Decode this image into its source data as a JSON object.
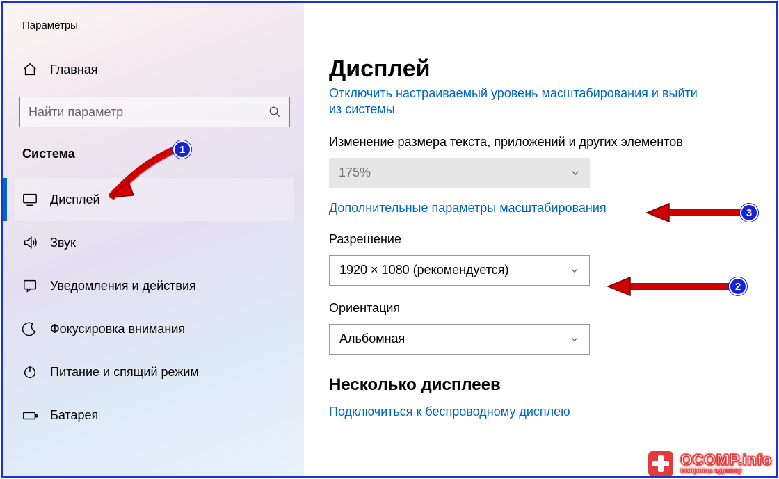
{
  "window": {
    "title": "Параметры"
  },
  "sidebar": {
    "home_label": "Главная",
    "search_placeholder": "Найти параметр",
    "group_label": "Система",
    "items": [
      {
        "label": "Дисплей",
        "icon": "monitor-icon",
        "active": true
      },
      {
        "label": "Звук",
        "icon": "speaker-icon",
        "active": false
      },
      {
        "label": "Уведомления и действия",
        "icon": "message-icon",
        "active": false
      },
      {
        "label": "Фокусировка внимания",
        "icon": "moon-icon",
        "active": false
      },
      {
        "label": "Питание и спящий режим",
        "icon": "power-icon",
        "active": false
      },
      {
        "label": "Батарея",
        "icon": "battery-icon",
        "active": false
      }
    ]
  },
  "main": {
    "page_title": "Дисплей",
    "top_link_line1": "Отключить настраиваемый уровень масштабирования и выйти",
    "top_link_line2": "из системы",
    "scale_label": "Изменение размера текста, приложений и других элементов",
    "scale_value": "175%",
    "scale_advanced_link": "Дополнительные параметры масштабирования",
    "resolution_label": "Разрешение",
    "resolution_value": "1920 × 1080 (рекомендуется)",
    "orientation_label": "Ориентация",
    "orientation_value": "Альбомная",
    "multi_display_heading": "Несколько дисплеев",
    "wireless_link": "Подключиться к беспроводному дисплею"
  },
  "annotations": {
    "badge1": "1",
    "badge2": "2",
    "badge3": "3"
  },
  "watermark": {
    "main": "OCOMP.info",
    "sub": "вопросы админу"
  }
}
